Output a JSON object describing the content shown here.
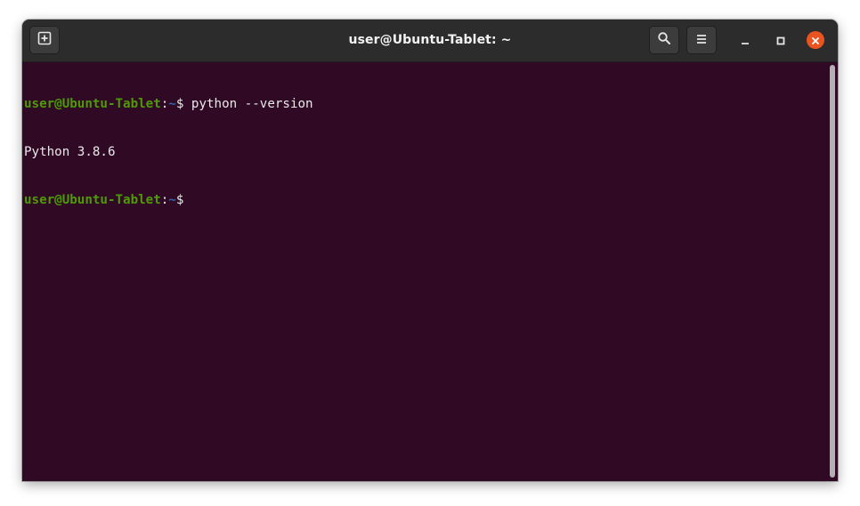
{
  "window": {
    "title": "user@Ubuntu-Tablet: ~"
  },
  "toolbar": {
    "new_tab_icon": "new-tab-icon",
    "search_icon": "search-icon",
    "menu_icon": "hamburger-menu-icon",
    "minimize_icon": "minimize-icon",
    "maximize_icon": "maximize-icon",
    "close_icon": "close-icon"
  },
  "terminal": {
    "lines": [
      {
        "user_host": "user@Ubuntu-Tablet",
        "sep": ":",
        "path": "~",
        "prompt": "$",
        "command": " python --version"
      },
      {
        "output": "Python 3.8.6"
      },
      {
        "user_host": "user@Ubuntu-Tablet",
        "sep": ":",
        "path": "~",
        "prompt": "$",
        "command": ""
      }
    ]
  },
  "colors": {
    "background": "#300a24",
    "user_host": "#4e9a06",
    "path": "#3465a4",
    "text": "#e9e9e9",
    "titlebar": "#2c2c2c",
    "close_accent": "#e95420"
  }
}
